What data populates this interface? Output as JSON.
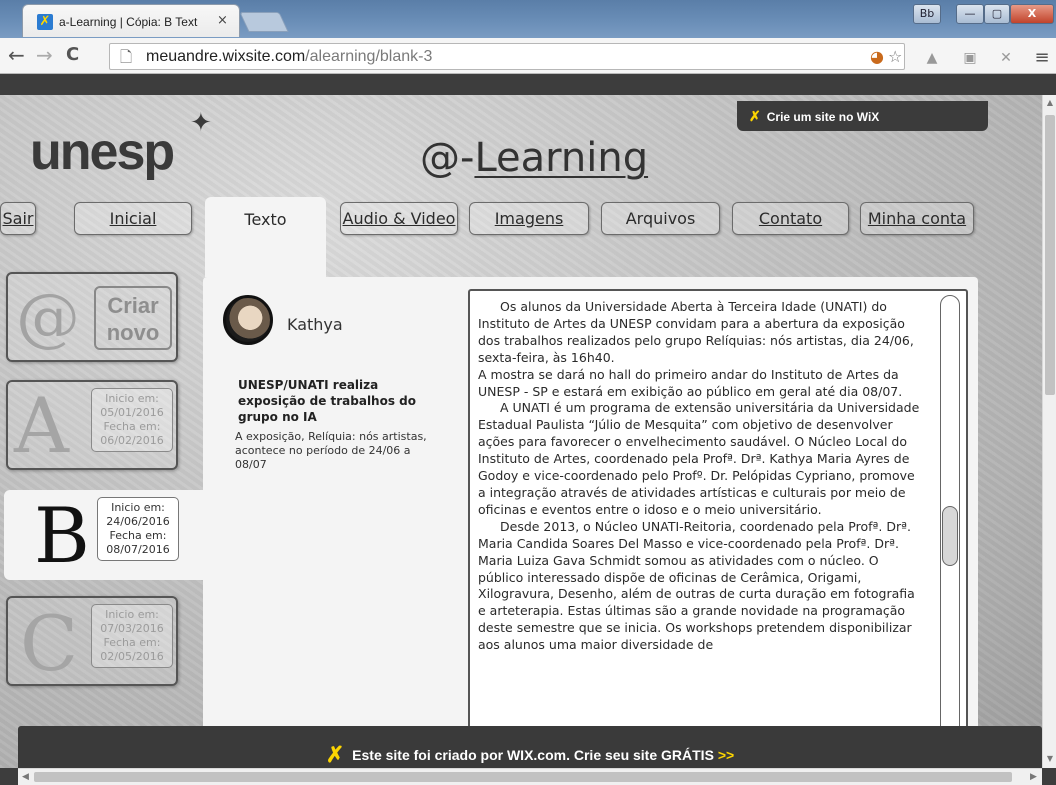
{
  "browser": {
    "tab_title": "a-Learning | Cópia: B Text",
    "tab_close": "×",
    "window_buttons": [
      "Bb",
      "—",
      "▢",
      "X"
    ],
    "url_host": "meuandre.wixsite.com",
    "url_path": "/alearning/blank-3",
    "nav_back": "←",
    "nav_forward": "→",
    "nav_reload": "C",
    "menu": "≡"
  },
  "site": {
    "logo": "unesp",
    "logo_mark": "✦",
    "title_prefix": "@-",
    "title_link": "Learning",
    "wix_ribbon_icon": "✗",
    "wix_ribbon": "Crie um site no WiX"
  },
  "nav": {
    "sair": "Sair",
    "inicial": "Inicial",
    "texto": "Texto",
    "audio_video": "Audio & Video",
    "imagens": "Imagens",
    "arquivos": "Arquivos",
    "contato": "Contato",
    "minha_conta": "Minha conta"
  },
  "sidebar": {
    "criar_at": "@",
    "criar_line1": "Criar",
    "criar_line2": "novo",
    "cards": [
      {
        "letter": "A",
        "l1": "Inicio em:",
        "l2": "05/01/2016",
        "l3": "Fecha em:",
        "l4": "06/02/2016"
      },
      {
        "letter": "B",
        "l1": "Inicio em:",
        "l2": "24/06/2016",
        "l3": "Fecha em:",
        "l4": "08/07/2016"
      },
      {
        "letter": "C",
        "l1": "Inicio em:",
        "l2": "07/03/2016",
        "l3": "Fecha em:",
        "l4": "02/05/2016"
      }
    ]
  },
  "post": {
    "author": "Kathya",
    "summary_title": "UNESP/UNATI realiza exposição de trabalhos do grupo no IA",
    "summary_body": "A exposição, Relíquia: nós artistas, acontece no período de 24/06 a 08/07",
    "article": {
      "p1": "Os alunos da Universidade Aberta à Terceira Idade (UNATI) do Instituto de Artes da UNESP convidam para a abertura da exposição dos trabalhos realizados pelo grupo Relíquias: nós artistas, dia 24/06, sexta-feira, às 16h40.",
      "p2": "A mostra se dará no hall do primeiro andar do Instituto de Artes da UNESP - SP e estará em exibição ao público em geral até dia 08/07.",
      "p3": "A UNATI é um programa de extensão universitária da Universidade Estadual Paulista “Júlio de Mesquita” com objetivo de desenvolver ações para favorecer o envelhecimento saudável. O Núcleo Local do Instituto de Artes, coordenado pela Profª. Drª. Kathya Maria Ayres de Godoy e vice-coordenado pelo Profº. Dr. Pelópidas Cypriano, promove a integração através de atividades artísticas e culturais por meio de oficinas e eventos entre o idoso e o meio universitário.",
      "p4": "Desde 2013, o Núcleo UNATI-Reitoria, coordenado pela Profª. Drª. Maria Candida Soares Del Masso e vice-coordenado pela Profª. Drª. Maria Luiza Gava Schmidt somou as atividades com o núcleo. O público interessado dispõe de oficinas de Cerâmica, Origami, Xilogravura, Desenho, além de outras de curta duração em fotografia e arteterapia. Estas últimas são a grande novidade na programação deste semestre que se inicia. Os workshops pretendem disponibilizar aos alunos uma maior diversidade de"
    }
  },
  "banner": {
    "icon": "✗",
    "text": "Este site foi criado por WIX.com. Crie seu site GRÁTIS",
    "arrow": ">>"
  },
  "colors": {
    "wix_yellow": "#fcd501",
    "banner_bg": "#3a3a3a",
    "panel_bg": "#f4f4f4"
  },
  "icons": [
    "page-icon",
    "star-icon",
    "extension-icon",
    "menu-icon",
    "avatar",
    "wix-icon"
  ]
}
